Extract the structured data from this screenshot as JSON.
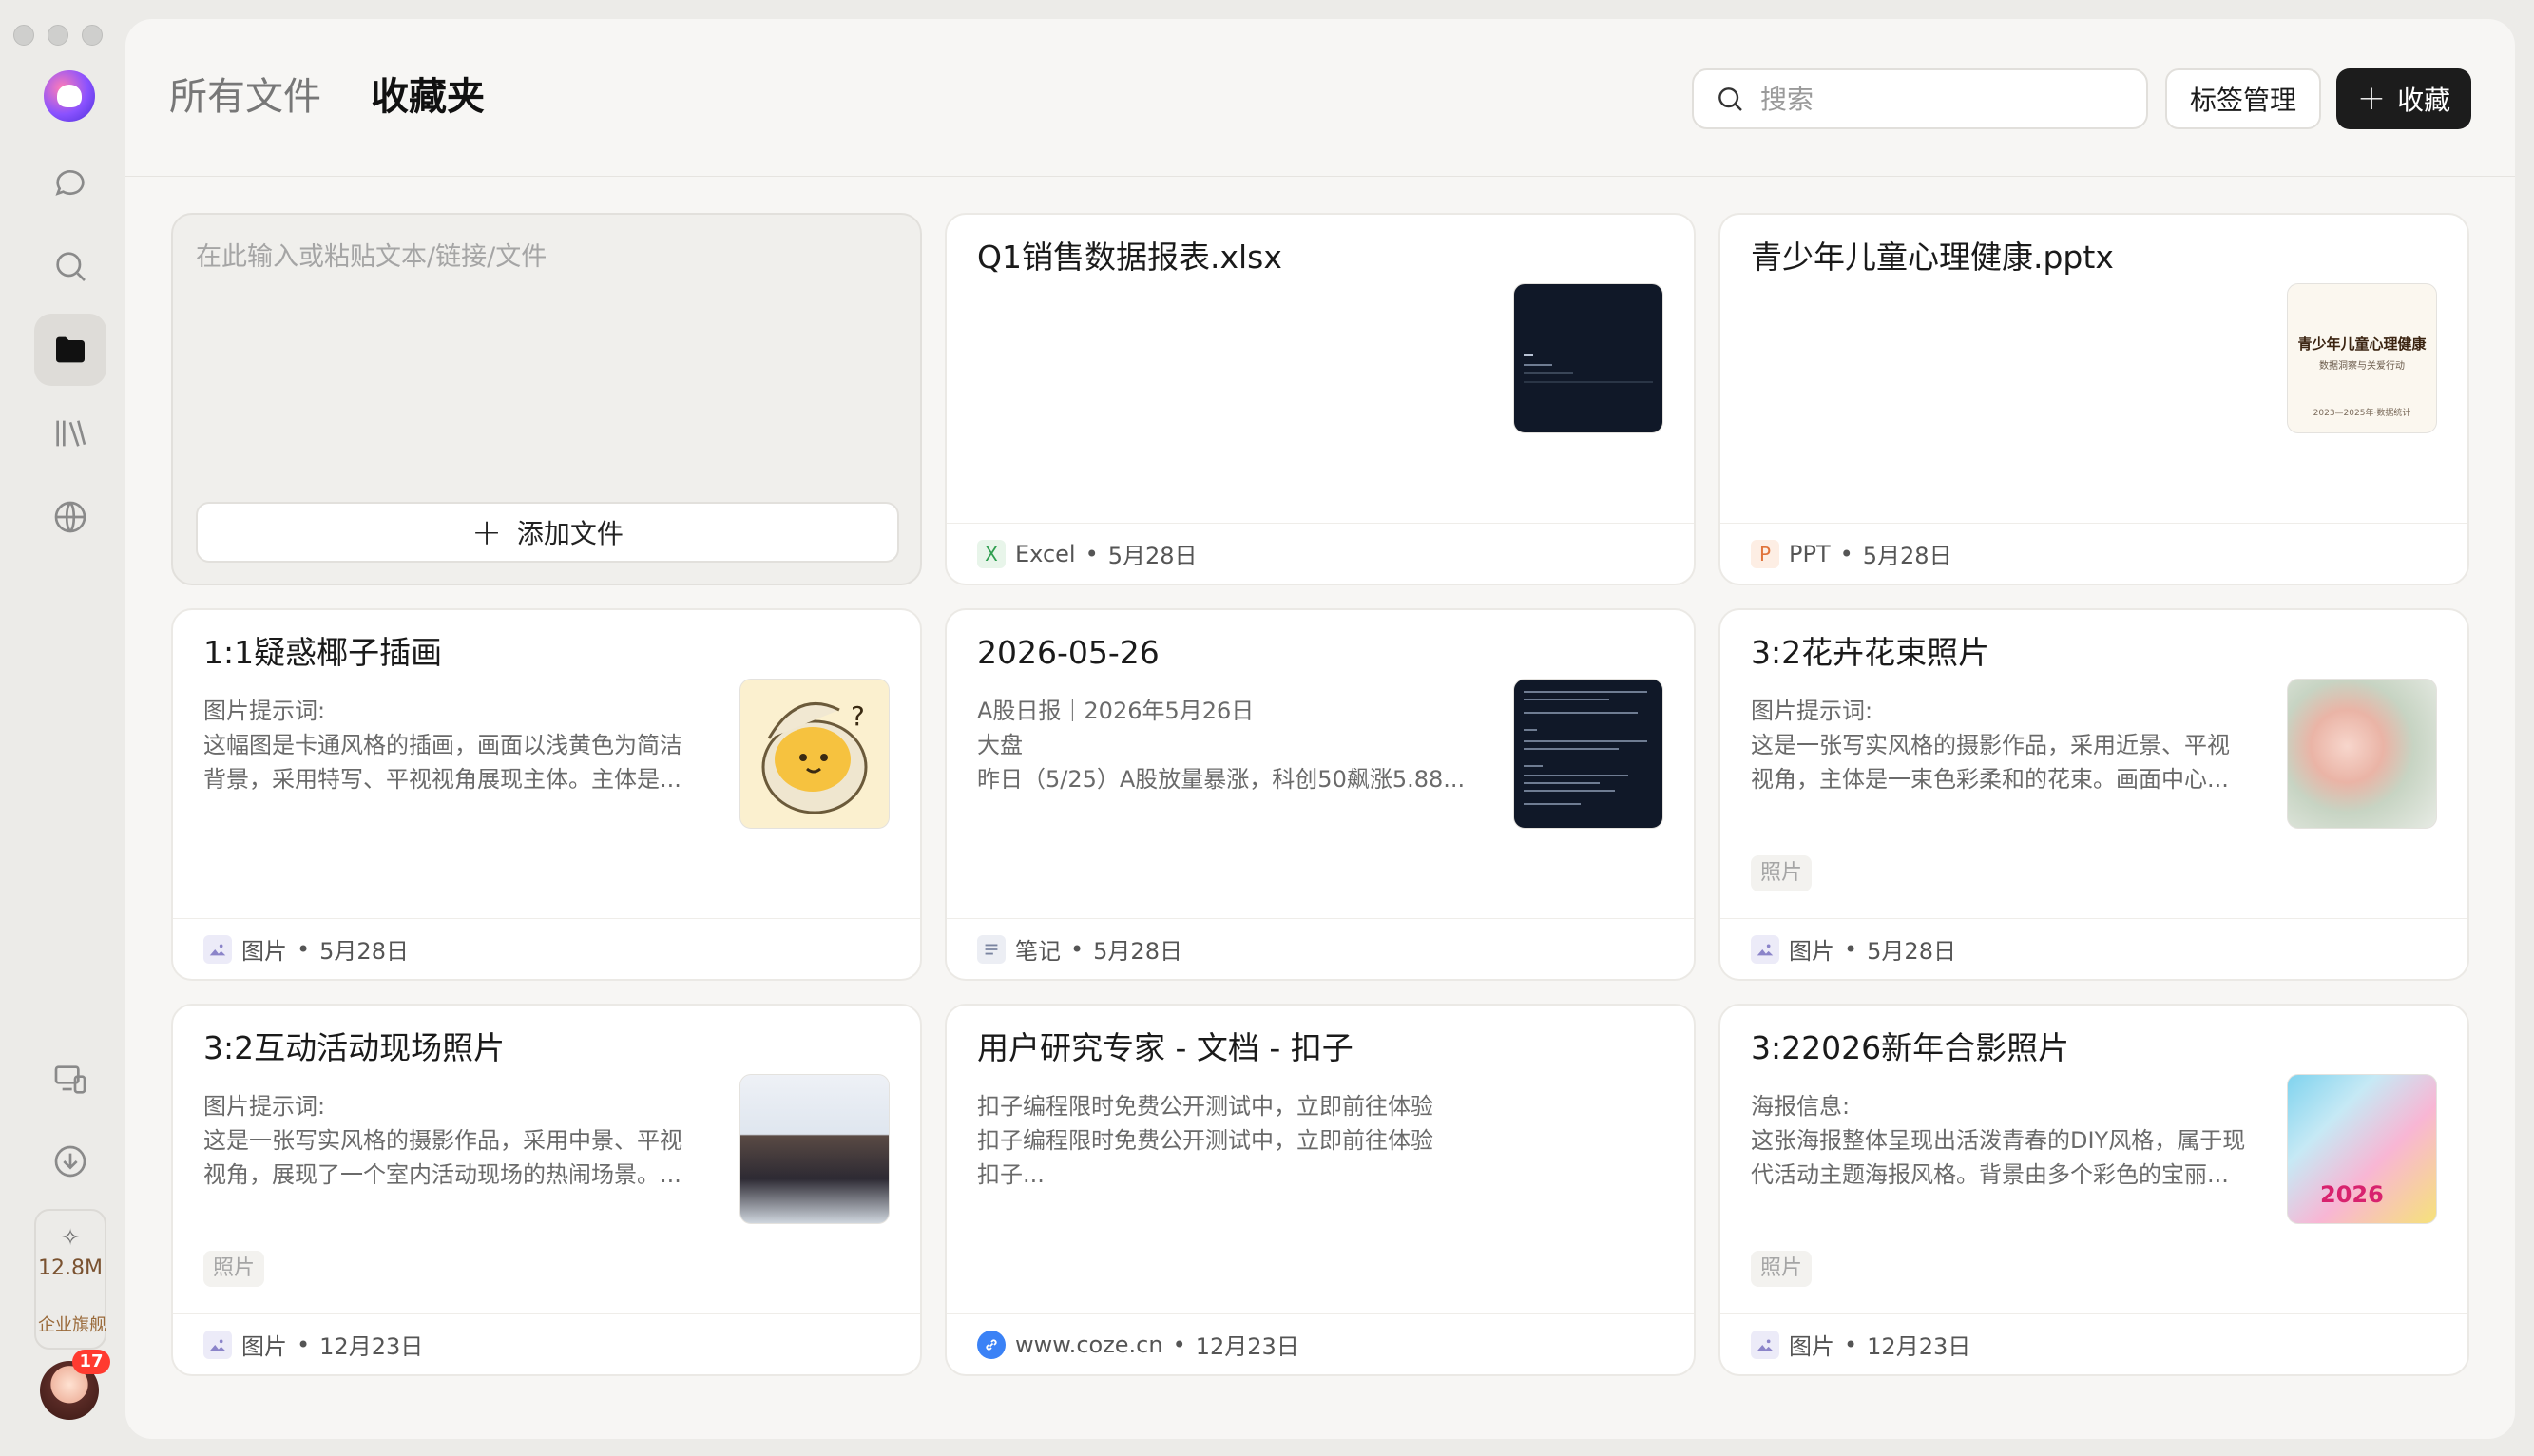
{
  "sidebar": {
    "quota": {
      "amount": "12.8M",
      "tier": "企业旗舰"
    },
    "avatar_badge": "17"
  },
  "header": {
    "tabs": [
      "所有文件",
      "收藏夹"
    ],
    "search_placeholder": "搜索",
    "tags_button": "标签管理",
    "favorite_button": "收藏"
  },
  "composer": {
    "placeholder": "在此输入或粘贴文本/链接/文件",
    "add_file": "添加文件"
  },
  "cards": [
    {
      "title": "Q1销售数据报表.xlsx",
      "type": "Excel",
      "date": "5月28日",
      "icon": "excel-icon"
    },
    {
      "title": "青少年儿童心理健康.pptx",
      "type": "PPT",
      "date": "5月28日",
      "icon": "ppt-icon",
      "thumb_text": [
        "青少年儿童心理健康",
        "数据洞察与关爱行动",
        "2023—2025年·数据统计"
      ]
    },
    {
      "title": "1:1疑惑椰子插画",
      "desc": [
        "图片提示词:",
        "这幅图是卡通风格的插画，画面以浅黄色为简洁",
        "背景，采用特写、平视视角展现主体。主体是..."
      ],
      "type": "图片",
      "date": "5月28日",
      "icon": "image-icon"
    },
    {
      "title": "2026-05-26",
      "desc": [
        "A股日报｜2026年5月26日",
        "大盘",
        "昨日（5/25）A股放量暴涨，科创50飙涨5.88..."
      ],
      "type": "笔记",
      "date": "5月28日",
      "icon": "note-icon"
    },
    {
      "title": "3:2花卉花束照片",
      "desc": [
        "图片提示词:",
        "这是一张写实风格的摄影作品，采用近景、平视",
        "视角，主体是一束色彩柔和的花束。画面中心..."
      ],
      "tag": "照片",
      "type": "图片",
      "date": "5月28日",
      "icon": "image-icon"
    },
    {
      "title": "3:2互动活动现场照片",
      "desc": [
        "图片提示词:",
        "这是一张写实风格的摄影作品，采用中景、平视",
        "视角，展现了一个室内活动现场的热闹场景。..."
      ],
      "tag": "照片",
      "type": "图片",
      "date": "12月23日",
      "icon": "image-icon"
    },
    {
      "title": "用户研究专家 - 文档 - 扣子",
      "desc": [
        "扣子编程限时免费公开测试中，立即前往体验",
        "扣子编程限时免费公开测试中，立即前往体验",
        "扣子..."
      ],
      "type": "www.coze.cn",
      "date": "12月23日",
      "icon": "link-icon"
    },
    {
      "title": "3:22026新年合影照片",
      "desc": [
        "海报信息:",
        "这张海报整体呈现出活泼青春的DIY风格，属于现",
        "代活动主题海报风格。背景由多个彩色的宝丽..."
      ],
      "tag": "照片",
      "type": "图片",
      "date": "12月23日",
      "icon": "image-icon",
      "thumb_text": "2026"
    }
  ],
  "colors": {
    "primary_button": "#1c1c1c",
    "background": "#f7f6f4",
    "badge": "#ff3b30"
  }
}
